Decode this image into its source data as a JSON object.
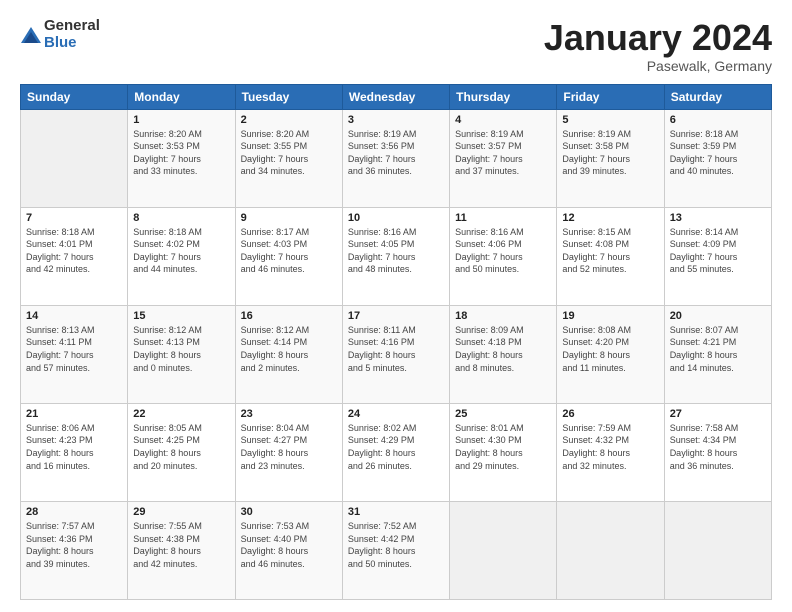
{
  "logo": {
    "general": "General",
    "blue": "Blue"
  },
  "title": {
    "month": "January 2024",
    "location": "Pasewalk, Germany"
  },
  "header": {
    "days": [
      "Sunday",
      "Monday",
      "Tuesday",
      "Wednesday",
      "Thursday",
      "Friday",
      "Saturday"
    ]
  },
  "weeks": [
    [
      {
        "day": "",
        "info": ""
      },
      {
        "day": "1",
        "info": "Sunrise: 8:20 AM\nSunset: 3:53 PM\nDaylight: 7 hours\nand 33 minutes."
      },
      {
        "day": "2",
        "info": "Sunrise: 8:20 AM\nSunset: 3:55 PM\nDaylight: 7 hours\nand 34 minutes."
      },
      {
        "day": "3",
        "info": "Sunrise: 8:19 AM\nSunset: 3:56 PM\nDaylight: 7 hours\nand 36 minutes."
      },
      {
        "day": "4",
        "info": "Sunrise: 8:19 AM\nSunset: 3:57 PM\nDaylight: 7 hours\nand 37 minutes."
      },
      {
        "day": "5",
        "info": "Sunrise: 8:19 AM\nSunset: 3:58 PM\nDaylight: 7 hours\nand 39 minutes."
      },
      {
        "day": "6",
        "info": "Sunrise: 8:18 AM\nSunset: 3:59 PM\nDaylight: 7 hours\nand 40 minutes."
      }
    ],
    [
      {
        "day": "7",
        "info": "Sunrise: 8:18 AM\nSunset: 4:01 PM\nDaylight: 7 hours\nand 42 minutes."
      },
      {
        "day": "8",
        "info": "Sunrise: 8:18 AM\nSunset: 4:02 PM\nDaylight: 7 hours\nand 44 minutes."
      },
      {
        "day": "9",
        "info": "Sunrise: 8:17 AM\nSunset: 4:03 PM\nDaylight: 7 hours\nand 46 minutes."
      },
      {
        "day": "10",
        "info": "Sunrise: 8:16 AM\nSunset: 4:05 PM\nDaylight: 7 hours\nand 48 minutes."
      },
      {
        "day": "11",
        "info": "Sunrise: 8:16 AM\nSunset: 4:06 PM\nDaylight: 7 hours\nand 50 minutes."
      },
      {
        "day": "12",
        "info": "Sunrise: 8:15 AM\nSunset: 4:08 PM\nDaylight: 7 hours\nand 52 minutes."
      },
      {
        "day": "13",
        "info": "Sunrise: 8:14 AM\nSunset: 4:09 PM\nDaylight: 7 hours\nand 55 minutes."
      }
    ],
    [
      {
        "day": "14",
        "info": "Sunrise: 8:13 AM\nSunset: 4:11 PM\nDaylight: 7 hours\nand 57 minutes."
      },
      {
        "day": "15",
        "info": "Sunrise: 8:12 AM\nSunset: 4:13 PM\nDaylight: 8 hours\nand 0 minutes."
      },
      {
        "day": "16",
        "info": "Sunrise: 8:12 AM\nSunset: 4:14 PM\nDaylight: 8 hours\nand 2 minutes."
      },
      {
        "day": "17",
        "info": "Sunrise: 8:11 AM\nSunset: 4:16 PM\nDaylight: 8 hours\nand 5 minutes."
      },
      {
        "day": "18",
        "info": "Sunrise: 8:09 AM\nSunset: 4:18 PM\nDaylight: 8 hours\nand 8 minutes."
      },
      {
        "day": "19",
        "info": "Sunrise: 8:08 AM\nSunset: 4:20 PM\nDaylight: 8 hours\nand 11 minutes."
      },
      {
        "day": "20",
        "info": "Sunrise: 8:07 AM\nSunset: 4:21 PM\nDaylight: 8 hours\nand 14 minutes."
      }
    ],
    [
      {
        "day": "21",
        "info": "Sunrise: 8:06 AM\nSunset: 4:23 PM\nDaylight: 8 hours\nand 16 minutes."
      },
      {
        "day": "22",
        "info": "Sunrise: 8:05 AM\nSunset: 4:25 PM\nDaylight: 8 hours\nand 20 minutes."
      },
      {
        "day": "23",
        "info": "Sunrise: 8:04 AM\nSunset: 4:27 PM\nDaylight: 8 hours\nand 23 minutes."
      },
      {
        "day": "24",
        "info": "Sunrise: 8:02 AM\nSunset: 4:29 PM\nDaylight: 8 hours\nand 26 minutes."
      },
      {
        "day": "25",
        "info": "Sunrise: 8:01 AM\nSunset: 4:30 PM\nDaylight: 8 hours\nand 29 minutes."
      },
      {
        "day": "26",
        "info": "Sunrise: 7:59 AM\nSunset: 4:32 PM\nDaylight: 8 hours\nand 32 minutes."
      },
      {
        "day": "27",
        "info": "Sunrise: 7:58 AM\nSunset: 4:34 PM\nDaylight: 8 hours\nand 36 minutes."
      }
    ],
    [
      {
        "day": "28",
        "info": "Sunrise: 7:57 AM\nSunset: 4:36 PM\nDaylight: 8 hours\nand 39 minutes."
      },
      {
        "day": "29",
        "info": "Sunrise: 7:55 AM\nSunset: 4:38 PM\nDaylight: 8 hours\nand 42 minutes."
      },
      {
        "day": "30",
        "info": "Sunrise: 7:53 AM\nSunset: 4:40 PM\nDaylight: 8 hours\nand 46 minutes."
      },
      {
        "day": "31",
        "info": "Sunrise: 7:52 AM\nSunset: 4:42 PM\nDaylight: 8 hours\nand 50 minutes."
      },
      {
        "day": "",
        "info": ""
      },
      {
        "day": "",
        "info": ""
      },
      {
        "day": "",
        "info": ""
      }
    ]
  ]
}
